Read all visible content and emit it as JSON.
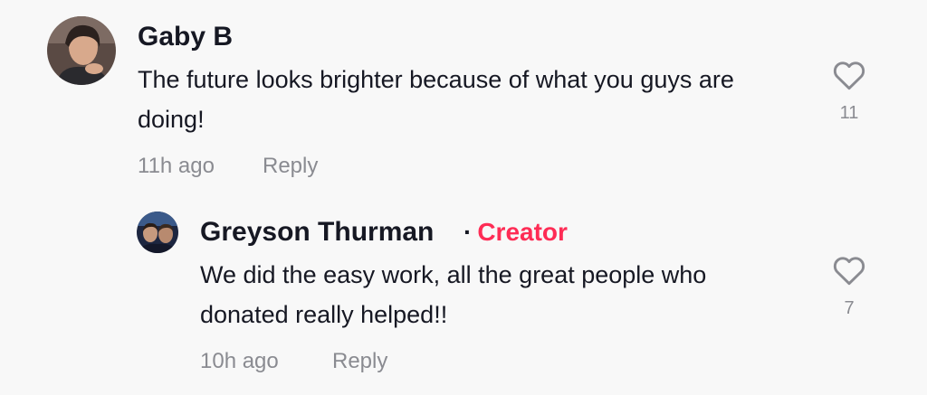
{
  "comments": [
    {
      "author": "Gaby B",
      "avatar_icon": "user-photo-avatar",
      "text": "The future looks brighter because of what you guys are doing!",
      "time": "11h ago",
      "reply_label": "Reply",
      "likes": "11"
    }
  ],
  "reply": {
    "author": "Greyson Thurman",
    "separator": "·",
    "badge": "Creator",
    "badge_color": "#fe2c55",
    "avatar_icon": "user-photo-avatar",
    "text": "We did the easy work, all the great people who donated really helped!!",
    "time": "10h ago",
    "reply_label": "Reply",
    "likes": "7"
  },
  "icons": {
    "like": "heart-outline-icon"
  }
}
